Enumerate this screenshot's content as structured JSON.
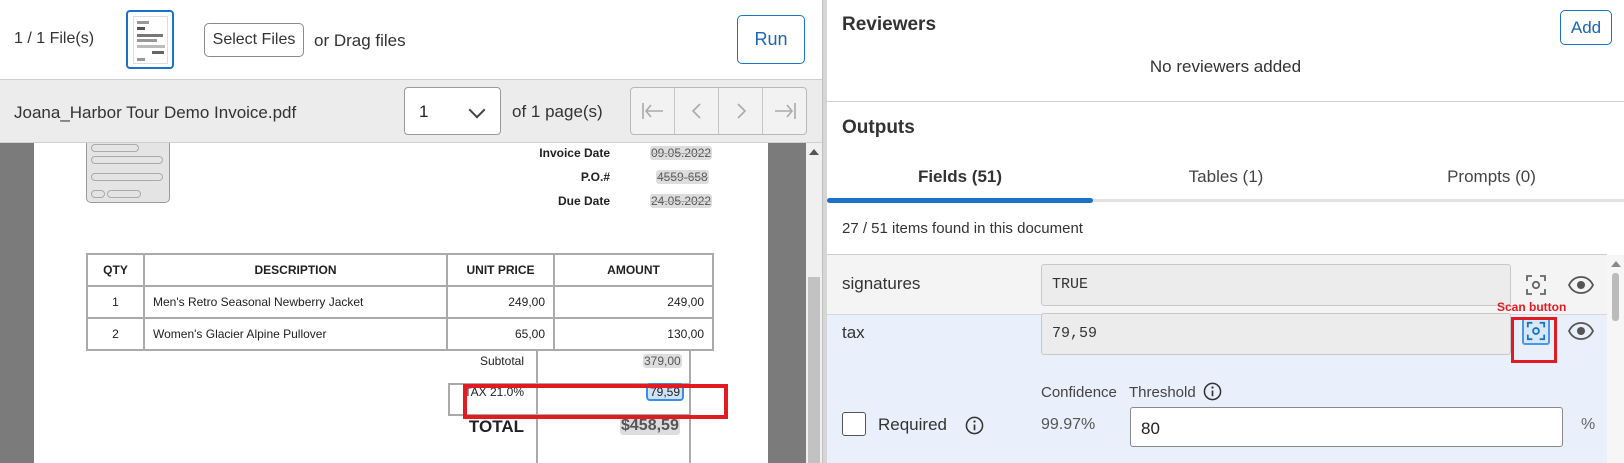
{
  "left_panel": {
    "file_count": "1 / 1 File(s)",
    "select_files_label": "Select Files",
    "drag_text": "or Drag files",
    "run_label": "Run",
    "file_name": "Joana_Harbor Tour Demo Invoice.pdf",
    "page_selected": "1",
    "of_pages": "of 1 page(s)",
    "nav": {
      "first": "|←",
      "prev": "<",
      "next": ">",
      "last": "→|"
    }
  },
  "invoice": {
    "meta": [
      {
        "label": "Invoice Date",
        "value": "09.05.2022"
      },
      {
        "label": "P.O.#",
        "value": "4559-658"
      },
      {
        "label": "Due Date",
        "value": "24.05.2022"
      }
    ],
    "columns": [
      "QTY",
      "DESCRIPTION",
      "UNIT PRICE",
      "AMOUNT"
    ],
    "rows": [
      {
        "qty": "1",
        "description": "Men's Retro Seasonal Newberry Jacket",
        "unit_price": "249,00",
        "amount": "249,00"
      },
      {
        "qty": "2",
        "description": "Women's Glacier Alpine Pullover",
        "unit_price": "65,00",
        "amount": "130,00"
      }
    ],
    "subtotal_label": "Subtotal",
    "subtotal_value": "379,00",
    "tax_label": "TAX 21.0%",
    "tax_value": "79,59",
    "total_label": "TOTAL",
    "total_value": "$458,59"
  },
  "right_panel": {
    "reviewers_title": "Reviewers",
    "add_label": "Add",
    "no_reviewers": "No reviewers added",
    "outputs_title": "Outputs",
    "tabs": [
      {
        "label": "Fields (51)",
        "active": true
      },
      {
        "label": "Tables (1)",
        "active": false
      },
      {
        "label": "Prompts (0)",
        "active": false
      }
    ],
    "items_found": "27 / 51 items found in this document",
    "fields": [
      {
        "name": "signatures",
        "value": "TRUE"
      },
      {
        "name": "tax",
        "value": "79,59"
      }
    ],
    "scan_annotation": "Scan button",
    "required_label": "Required",
    "confidence_label": "Confidence",
    "confidence_value": "99.97%",
    "threshold_label": "Threshold",
    "threshold_value": "80",
    "percent_sign": "%"
  },
  "colors": {
    "accent": "#1a73c8",
    "highlight_red": "#e21b23",
    "selected_row": "#e9effb"
  }
}
